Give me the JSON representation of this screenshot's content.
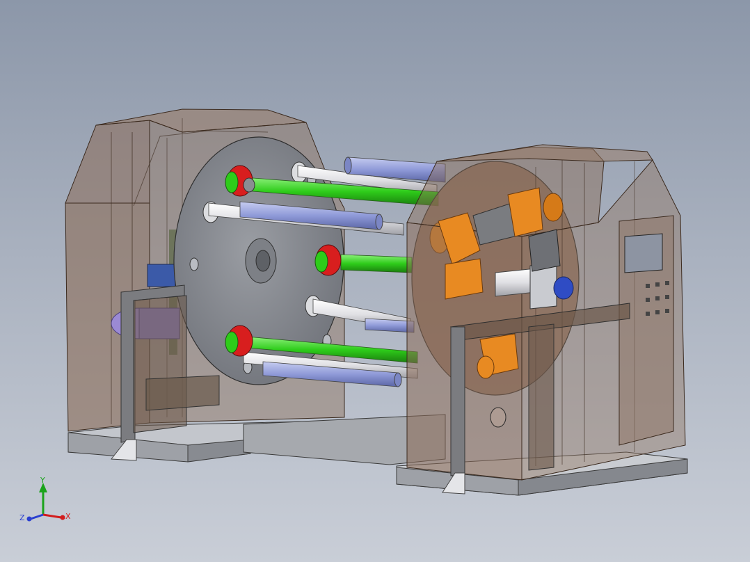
{
  "view": {
    "background_top": "#8c97a9",
    "background_bottom": "#c9ced7"
  },
  "triad": {
    "y_label": "Y",
    "x_label": "X",
    "z_label": "Z",
    "y_color": "#1aa31a",
    "x_color": "#d21c1c",
    "z_color": "#2a3fd0"
  },
  "model": {
    "housing_color": "#8a6a55",
    "roller_green": "#2ecc1a",
    "roller_blue": "#8f9ad8",
    "roller_white": "#e6e6ea",
    "hub_red": "#d81e1e",
    "motor_orange": "#e88a22",
    "plate_gray": "#8d9096",
    "base_gray": "#9a9ca1"
  }
}
